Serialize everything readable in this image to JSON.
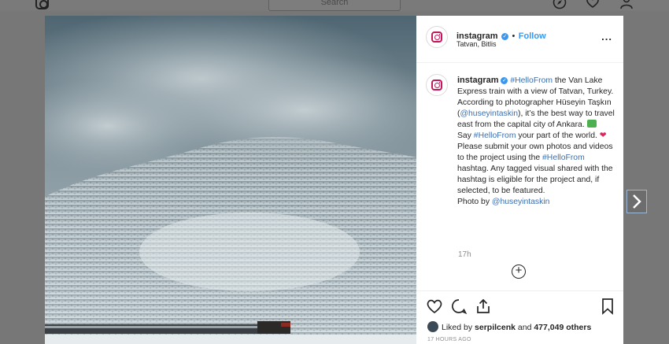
{
  "topbar": {
    "search_placeholder": "Search"
  },
  "header": {
    "username": "instagram",
    "separator": "•",
    "follow_label": "Follow",
    "location": "Tatvan, Bitlis",
    "more": "..."
  },
  "caption": {
    "username": "instagram",
    "parts": {
      "p1_tag": "#HelloFrom",
      "p2": " the Van Lake Express train with a view of Tatvan, Turkey. According to photographer Hüseyin Taşkın (",
      "p3_mention": "@huseyintaskin",
      "p4": "), it’s the best way to travel east from the capital city of Ankara. ",
      "p5": "Say ",
      "p6_tag": "#HelloFrom",
      "p7": " your part of the world. ",
      "p8": " Please submit your own photos and videos to the project using the ",
      "p9_tag": "#HelloFrom",
      "p10": " hashtag. Any tagged visual shared with the hashtag is eligible for the project and, if selected, to be featured.",
      "p11": "Photo by ",
      "p12_mention": "@huseyintaskin"
    },
    "heart_glyph": "❤",
    "time": "17h"
  },
  "comments": {
    "load_more": "+"
  },
  "footer": {
    "liked_by_prefix": "Liked by ",
    "liked_by_user": "serpilcenk",
    "liked_by_mid": " and ",
    "liked_by_count": "477,049 others",
    "ago": "17 HOURS AGO"
  },
  "colors": {
    "link": "#3897f0",
    "heart": "#e0245e",
    "brand": "#c2185b"
  }
}
